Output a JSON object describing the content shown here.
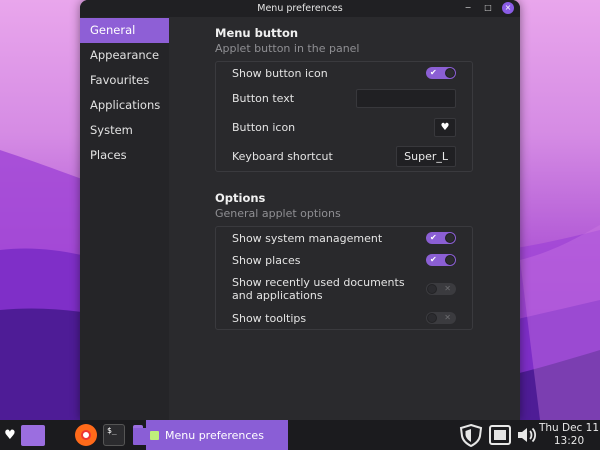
{
  "window": {
    "title": "Menu preferences",
    "controls": {
      "minimize": "−",
      "maximize": "□",
      "close": "×"
    }
  },
  "sidebar": {
    "items": [
      {
        "label": "General",
        "active": true
      },
      {
        "label": "Appearance",
        "active": false
      },
      {
        "label": "Favourites",
        "active": false
      },
      {
        "label": "Applications",
        "active": false
      },
      {
        "label": "System",
        "active": false
      },
      {
        "label": "Places",
        "active": false
      }
    ]
  },
  "menu_button": {
    "title": "Menu button",
    "subtitle": "Applet button in the panel",
    "show_button_icon": {
      "label": "Show button icon",
      "enabled": true
    },
    "button_text": {
      "label": "Button text",
      "value": ""
    },
    "button_icon": {
      "label": "Button icon",
      "icon": "heart-icon"
    },
    "keyboard_shortcut": {
      "label": "Keyboard shortcut",
      "value": "Super_L"
    }
  },
  "options": {
    "title": "Options",
    "subtitle": "General applet options",
    "system_management": {
      "label": "Show system management",
      "enabled": true
    },
    "places": {
      "label": "Show places",
      "enabled": true
    },
    "recent_docs": {
      "label_line1": "Show recently used documents",
      "label_line2": "and applications",
      "enabled": false
    },
    "tooltips": {
      "label": "Show tooltips",
      "enabled": false
    }
  },
  "taskbar": {
    "menu_icon": "heart-icon",
    "launchers": [
      "files-purple-icon",
      "firefox-icon",
      "terminal-icon",
      "folder-icon"
    ],
    "terminal_glyph": "$_",
    "active_window": "Menu preferences",
    "tray": [
      "shield-icon",
      "window-icon",
      "volume-icon"
    ],
    "clock": {
      "date": "Thu Dec 11",
      "time": "13:20"
    }
  },
  "colors": {
    "accent": "#8b5fd4",
    "window_bg": "#2a2a2d",
    "sidebar_bg": "#252528",
    "taskbar_bg": "#1b1b1e"
  }
}
